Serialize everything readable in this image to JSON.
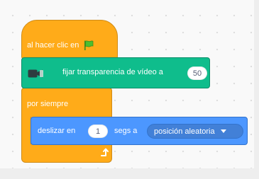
{
  "canvas": {
    "background": "#f9f9f9",
    "dot_color": "#dcdcdc"
  },
  "blocks": {
    "hat": {
      "label": "al hacer clic en",
      "icon": "green-flag-icon",
      "color": "#ffab19"
    },
    "video_transparency": {
      "label": "fijar transparencia de vídeo a",
      "value": "50",
      "icon": "video-camera-icon",
      "color": "#0fbd8c"
    },
    "forever": {
      "label": "por siempre",
      "icon": "loop-arrow-icon",
      "color": "#ffab19"
    },
    "glide": {
      "label_before": "deslizar en",
      "value": "1",
      "label_after": "segs a",
      "target": "posición aleatoria",
      "dropdown_icon": "caret-down-icon",
      "color": "#4c97ff"
    }
  }
}
